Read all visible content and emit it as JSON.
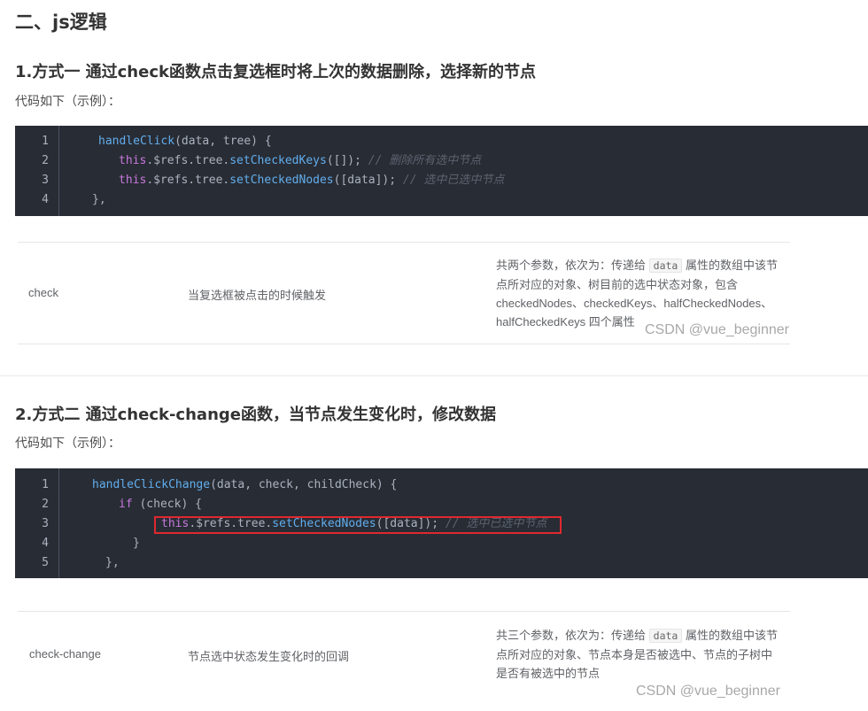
{
  "heading_main": "二、js逻辑",
  "method1": {
    "title": "1.方式一 通过check函数点击复选框时将上次的数据删除，选择新的节点",
    "intro": "代码如下（示例）：",
    "code": {
      "line_numbers": [
        "1",
        "2",
        "3",
        "4"
      ],
      "l1_fn": "handleClick",
      "l1_rest": "(data, tree) {",
      "l2_this": "this",
      "l2_mid": ".$refs.tree.",
      "l2_fn": "setCheckedKeys",
      "l2_args": "([]); ",
      "l2_comment": "// 删除所有选中节点",
      "l3_this": "this",
      "l3_mid": ".$refs.tree.",
      "l3_fn": "setCheckedNodes",
      "l3_args": "([data]); ",
      "l3_comment": "// 选中已选中节点",
      "l4": "},"
    },
    "table": {
      "event": "check",
      "explanation": "当复选框被点击的时候触发",
      "params_prefix": "共两个参数，依次为：传递给",
      "params_code": "data",
      "params_suffix": "属性的数组中该节点所对应的对象、树目前的选中状态对象，包含 checkedNodes、checkedKeys、halfCheckedNodes、halfCheckedKeys 四个属性"
    }
  },
  "method2": {
    "title": "2.方式二 通过check-change函数，当节点发生变化时，修改数据",
    "intro": "代码如下（示例）：",
    "code": {
      "line_numbers": [
        "1",
        "2",
        "3",
        "4",
        "5"
      ],
      "l1_fn": "handleClickChange",
      "l1_rest": "(data, check, childCheck) {",
      "l2_kw": "if",
      "l2_rest": " (check) {",
      "l3_this": "this",
      "l3_mid": ".$refs.tree.",
      "l3_fn": "setCheckedNodes",
      "l3_args": "([data]); ",
      "l3_comment": "// 选中已选中节点",
      "l4": "}",
      "l5": "},"
    },
    "table": {
      "event": "check-change",
      "explanation": "节点选中状态发生变化时的回调",
      "params_prefix": "共三个参数，依次为：传递给",
      "params_code": "data",
      "params_suffix": "属性的数组中该节点所对应的对象、节点本身是否被选中、节点的子树中是否有被选中的节点"
    }
  },
  "watermark": "CSDN @vue_beginner",
  "colors": {
    "code_bg": "#282c34",
    "function": "#61aeee",
    "keyword": "#c678dd",
    "comment": "#5c6370",
    "highlight_box": "#e0282e"
  }
}
